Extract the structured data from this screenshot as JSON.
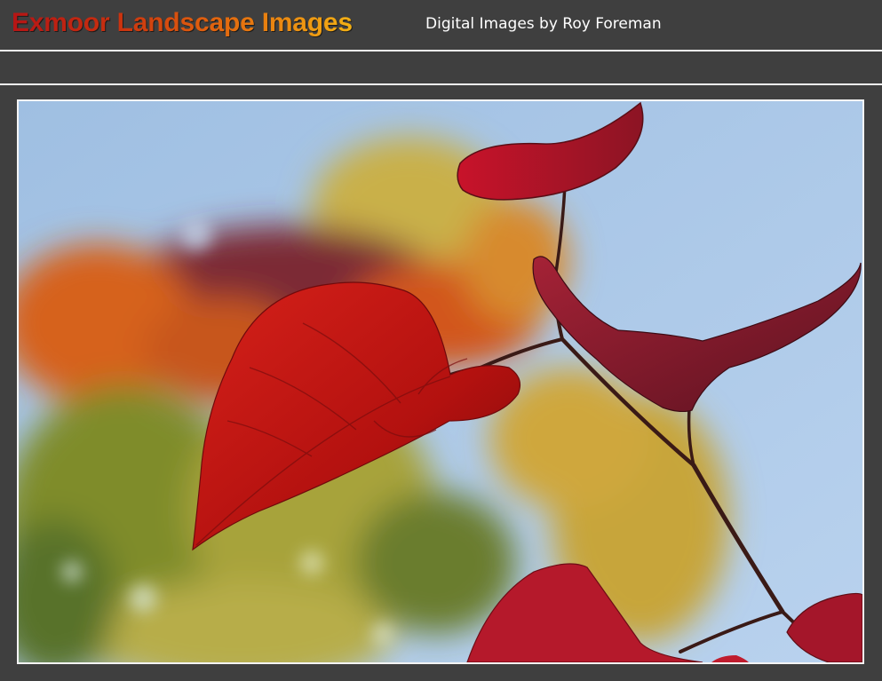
{
  "header": {
    "title": "Exmoor Landscape Images",
    "subtitle": "Digital Images by Roy Foreman"
  },
  "main": {
    "photo": {
      "description_icon": "photo-autumn-leaves"
    }
  },
  "colors": {
    "background": "#3f3f3f",
    "rule": "#f2f2f2",
    "title_gradient_start": "#b51515",
    "title_gradient_end": "#f3b014",
    "subtitle": "#ffffff"
  }
}
